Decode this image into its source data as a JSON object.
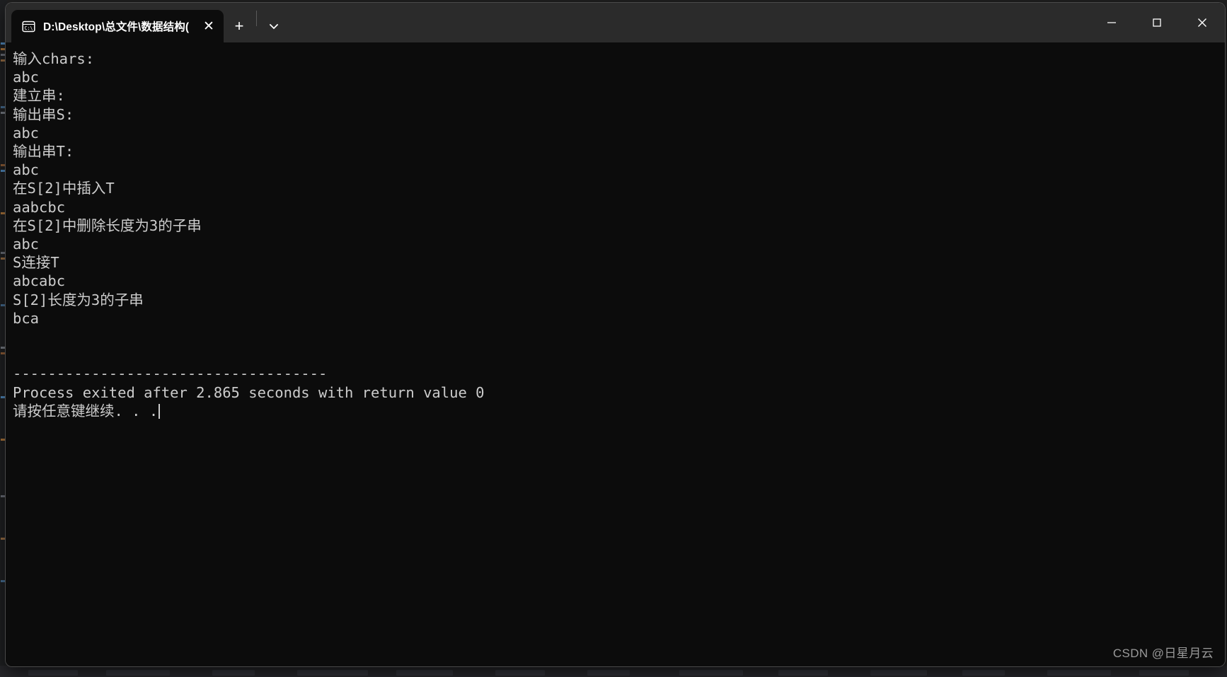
{
  "window": {
    "background_color": "#0c0c0c",
    "titlebar_color": "#2b2b2b",
    "text_color": "#cccccc"
  },
  "titlebar": {
    "tab": {
      "icon_name": "command-prompt-icon",
      "icon_label": "C:\\",
      "title": "D:\\Desktop\\总文件\\数据结构(",
      "close_label": "✕"
    },
    "new_tab_label": "+",
    "dropdown_label": "⌄",
    "controls": {
      "minimize_label": "—",
      "maximize_label": "▢",
      "close_label": "✕"
    }
  },
  "console": {
    "lines": [
      "输入chars:",
      "abc",
      "建立串:",
      "输出串S:",
      "abc",
      "输出串T:",
      "abc",
      "在S[2]中插入T",
      "aabcbc",
      "在S[2]中删除长度为3的子串",
      "abc",
      "S连接T",
      "abcabc",
      "S[2]长度为3的子串",
      "bca",
      "",
      "",
      "------------------------------------",
      "Process exited after 2.865 seconds with return value 0",
      "请按任意键继续. . ."
    ],
    "cursor_visible": true
  },
  "watermark": {
    "text": "CSDN @日星月云"
  }
}
